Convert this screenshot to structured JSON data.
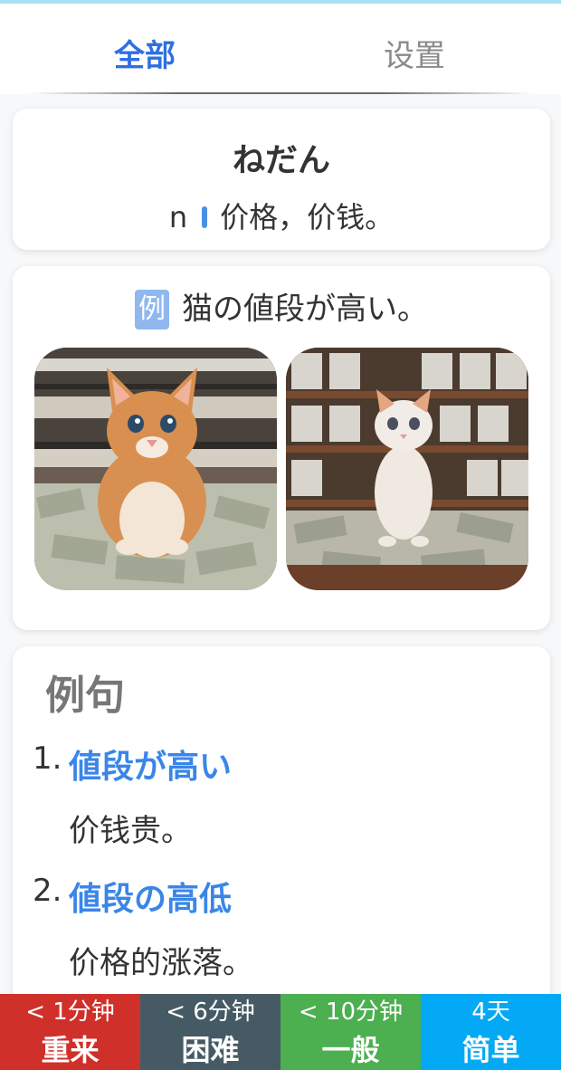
{
  "tabs": {
    "all": "全部",
    "settings": "设置"
  },
  "word": {
    "reading": "ねだん",
    "pos": "n",
    "meaning": "价格，价钱。"
  },
  "example": {
    "badge": "例",
    "text": "猫の値段が高い。",
    "images": [
      "orange tabby kitten sitting on piles of cash in a money warehouse",
      "white and orange kitten sitting on scattered cash with shelves of money"
    ]
  },
  "sentences": {
    "title": "例句",
    "items": [
      {
        "num": "1.",
        "jp": "値段が高い",
        "cn": "价钱贵。"
      },
      {
        "num": "2.",
        "jp": "値段の高低",
        "cn": "价格的涨落。"
      }
    ]
  },
  "buttons": [
    {
      "sub": "< 1分钟",
      "label": "重来"
    },
    {
      "sub": "< 6分钟",
      "label": "困难"
    },
    {
      "sub": "< 10分钟",
      "label": "一般"
    },
    {
      "sub": "4天",
      "label": "简单"
    }
  ],
  "colors": {
    "accent": "#2f6fe0",
    "again": "#d0302a",
    "hard": "#455a64",
    "good": "#4caf50",
    "easy": "#03a9f4"
  }
}
